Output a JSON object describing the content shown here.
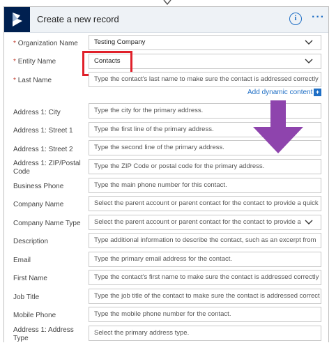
{
  "header": {
    "title": "Create a new record",
    "info_icon": "info-icon",
    "more_icon": "more-options-icon"
  },
  "colors": {
    "accent": "#1f6fc5",
    "logo_bg": "#002050",
    "highlight": "#e0202a",
    "annotation_arrow": "#8e44ad"
  },
  "fields": {
    "organization_name": {
      "label": "Organization Name",
      "required": true,
      "value": "Testing Company"
    },
    "entity_name": {
      "label": "Entity Name",
      "required": true,
      "value": "Contacts"
    },
    "last_name": {
      "label": "Last Name",
      "required": true,
      "placeholder": "Type the contact's last name to make sure the contact is addressed correctly i"
    },
    "address1_city": {
      "label": "Address 1: City",
      "placeholder": "Type the city for the primary address."
    },
    "address1_street1": {
      "label": "Address 1: Street 1",
      "placeholder": "Type the first line of the primary address."
    },
    "address1_street2": {
      "label": "Address 1: Street 2",
      "placeholder": "Type the second line of the primary address."
    },
    "address1_zip": {
      "label": "Address 1: ZIP/Postal Code",
      "placeholder": "Type the ZIP Code or postal code for the primary address."
    },
    "business_phone": {
      "label": "Business Phone",
      "placeholder": "Type the main phone number for this contact."
    },
    "company_name": {
      "label": "Company Name",
      "placeholder": "Select the parent account or parent contact for the contact to provide a quick"
    },
    "company_name_type": {
      "label": "Company Name Type",
      "placeholder": "Select the parent account or parent contact for the contact to provide a"
    },
    "description": {
      "label": "Description",
      "placeholder": "Type additional information to describe the contact, such as an excerpt from"
    },
    "email": {
      "label": "Email",
      "placeholder": "Type the primary email address for the contact."
    },
    "first_name": {
      "label": "First Name",
      "placeholder": "Type the contact's first name to make sure the contact is addressed correctly"
    },
    "job_title": {
      "label": "Job Title",
      "placeholder": "Type the job title of the contact to make sure the contact is addressed correct"
    },
    "mobile_phone": {
      "label": "Mobile Phone",
      "placeholder": "Type the mobile phone number for the contact."
    },
    "address1_type": {
      "label": "Address 1: Address Type",
      "placeholder": "Select the primary address type."
    }
  },
  "dynamic_content": {
    "label": "Add dynamic content",
    "icon": "plus-icon"
  }
}
